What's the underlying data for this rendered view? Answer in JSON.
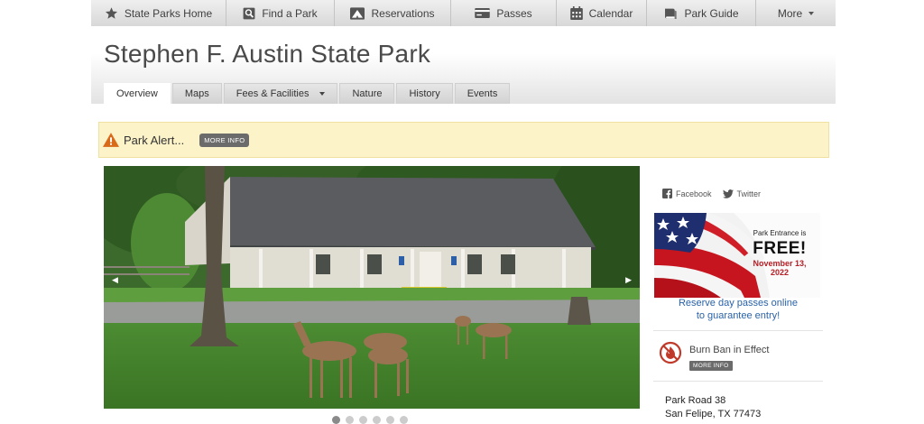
{
  "nav": {
    "items": [
      {
        "label": "State Parks Home",
        "icon": "star-icon"
      },
      {
        "label": "Find a Park",
        "icon": "search-icon"
      },
      {
        "label": "Reservations",
        "icon": "tent-icon"
      },
      {
        "label": "Passes",
        "icon": "pass-card-icon"
      },
      {
        "label": "Calendar",
        "icon": "calendar-icon"
      },
      {
        "label": "Park Guide",
        "icon": "book-icon"
      },
      {
        "label": "More",
        "icon": "chevron-down-icon"
      }
    ]
  },
  "header": {
    "title": "Stephen F. Austin State Park",
    "tabs": [
      {
        "label": "Overview",
        "active": true
      },
      {
        "label": "Maps"
      },
      {
        "label": "Fees & Facilities",
        "dropdown": true
      },
      {
        "label": "Nature"
      },
      {
        "label": "History"
      },
      {
        "label": "Events"
      }
    ]
  },
  "alert": {
    "text": "Park Alert...",
    "button": "MORE INFO",
    "icon": "warning-icon",
    "color": "#fcf3c8"
  },
  "slideshow": {
    "dots": 6,
    "active_dot": 0
  },
  "sidebar": {
    "social": [
      {
        "label": "Facebook",
        "icon": "facebook-icon"
      },
      {
        "label": "Twitter",
        "icon": "twitter-icon"
      }
    ],
    "promo": {
      "line1": "Park Entrance is",
      "line2": "FREE!",
      "line3": "November 13,",
      "line4": "2022",
      "caption_line1": "Reserve day passes online",
      "caption_line2": "to guarantee entry!"
    },
    "burn_ban": {
      "title": "Burn Ban in Effect",
      "button": "MORE INFO",
      "icon": "no-fire-icon"
    },
    "address": {
      "line1": "Park Road 38",
      "line2": "San Felipe, TX 77473"
    }
  },
  "colors": {
    "link": "#2a62a8",
    "alert_icon": "#d86a1a",
    "burn_icon": "#c03a2b"
  }
}
